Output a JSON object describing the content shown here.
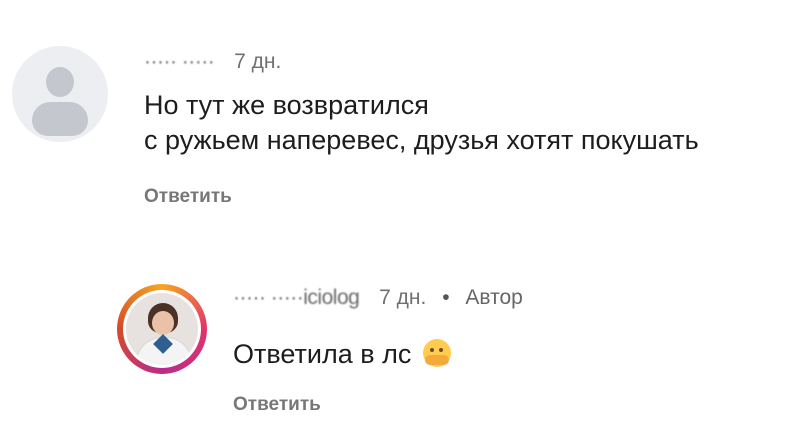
{
  "comments": [
    {
      "username": "····· ·····",
      "time": "7 дн.",
      "text_line1": "Но тут же возвратился",
      "text_line2": "с ружьем наперевес, друзья хотят покушать",
      "reply_label": "Ответить"
    },
    {
      "username": "····· ·····iciolog",
      "time": "7 дн.",
      "author_separator": "•",
      "author_badge": "Автор",
      "text": "Ответила в лс",
      "emoji": "hugging-face-icon",
      "reply_label": "Ответить"
    }
  ],
  "colors": {
    "text": "#1d1d1d",
    "meta": "#666666",
    "avatar_ring": "#e2336b"
  }
}
